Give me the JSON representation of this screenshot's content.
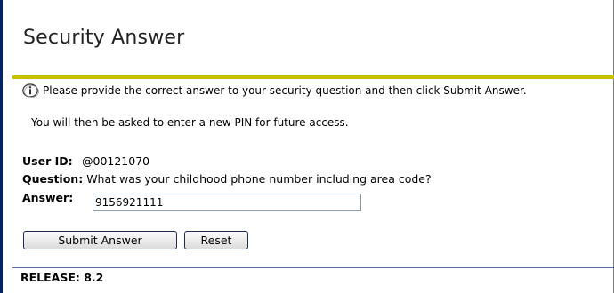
{
  "page": {
    "title": "Security Answer"
  },
  "info": {
    "icon": "info-icon",
    "line1": "Please provide the correct answer to your security question and then click Submit Answer.",
    "line2": "You will then be asked to enter a new PIN for future access."
  },
  "form": {
    "user_id_label": "User ID:",
    "user_id_value": "@00121070",
    "question_label": "Question:",
    "question_text": "What was your childhood phone number including area code?",
    "answer_label": "Answer:",
    "answer_value": "9156921111"
  },
  "buttons": {
    "submit_label": "Submit Answer",
    "reset_label": "Reset"
  },
  "footer": {
    "release": "RELEASE: 8.2"
  },
  "colors": {
    "accent_rule": "#c9bf00",
    "left_bar": "#00256b",
    "footer_rule": "#5a6da0"
  }
}
